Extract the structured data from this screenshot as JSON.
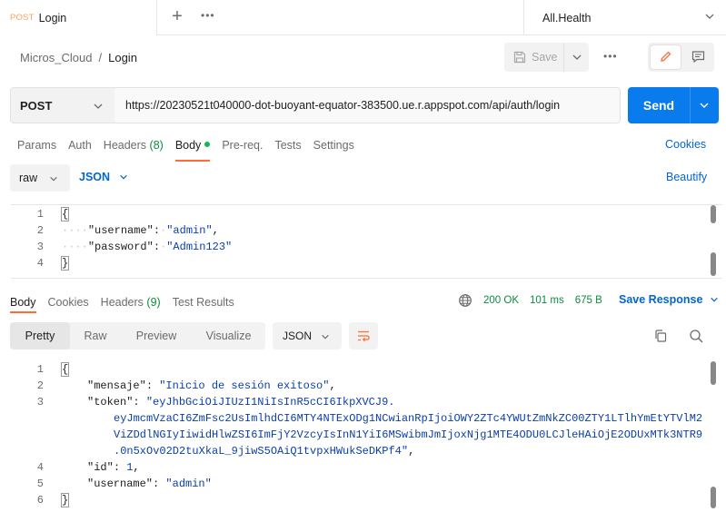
{
  "tabs": {
    "active": {
      "method": "POST",
      "name": "Login"
    },
    "new_tab": "+",
    "more": "•••",
    "environment": "All.Health"
  },
  "breadcrumb": {
    "collection": "Micros_Cloud",
    "separator": "/",
    "request": "Login"
  },
  "header": {
    "save_label": "Save",
    "more": "•••"
  },
  "request": {
    "method": "POST",
    "url": "https://20230521t040000-dot-buoyant-equator-383500.ue.r.appspot.com/api/auth/login",
    "send_label": "Send"
  },
  "request_tabs": [
    {
      "label": "Params"
    },
    {
      "label": "Auth"
    },
    {
      "label": "Headers",
      "count": "(8)"
    },
    {
      "label": "Body"
    },
    {
      "label": "Pre-req."
    },
    {
      "label": "Tests"
    },
    {
      "label": "Settings"
    }
  ],
  "cookies_label": "Cookies",
  "body_options": {
    "mode": "raw",
    "language": "JSON",
    "beautify": "Beautify"
  },
  "request_body": {
    "line_numbers": [
      "1",
      "2",
      "3",
      "4"
    ],
    "open": "{",
    "close": "}",
    "username_key": "\"username\"",
    "username_value": "\"admin\"",
    "password_key": "\"password\"",
    "password_value": "\"Admin123\""
  },
  "response_tabs": [
    {
      "label": "Body"
    },
    {
      "label": "Cookies"
    },
    {
      "label": "Headers",
      "count": "(9)"
    },
    {
      "label": "Test Results"
    }
  ],
  "response_stats": {
    "status": "200 OK",
    "time": "101 ms",
    "size": "675 B"
  },
  "save_response_label": "Save Response",
  "view_modes": [
    "Pretty",
    "Raw",
    "Preview",
    "Visualize"
  ],
  "format": "JSON",
  "response_body": {
    "line_numbers": [
      "1",
      "2",
      "3",
      "",
      "",
      "",
      "4",
      "5",
      "6"
    ],
    "open": "{",
    "close": "}",
    "mensaje_key": "\"mensaje\"",
    "mensaje_value": "\"Inicio de sesión exitoso\"",
    "token_key": "\"token\"",
    "token_line1": "\"eyJhbGciOiJIUzI1NiIsInR5cCI6IkpXVCJ9.",
    "token_line2": "eyJmcmVzaCI6ZmFsc2UsImlhdCI6MTY4NTExODg1NCwianRpIjoiOWY2ZTc4YWUtZmNkZC00ZTY1LTlhYmEtYTVlM2",
    "token_line3": "ViZDdlNGIyIiwidHlwZSI6ImFjY2VzcyIsInN1YiI6MSwibmJmIjoxNjg1MTE4ODU0LCJleHAiOjE2ODUxMTk3NTR9",
    "token_line4": ".0n5xOv02D2tuXkaL_9jiwS5OAiQ1tvpxHWukSeDKPf4\"",
    "id_key": "\"id\"",
    "id_value": "1",
    "username_key": "\"username\"",
    "username_value": "\"admin\""
  }
}
